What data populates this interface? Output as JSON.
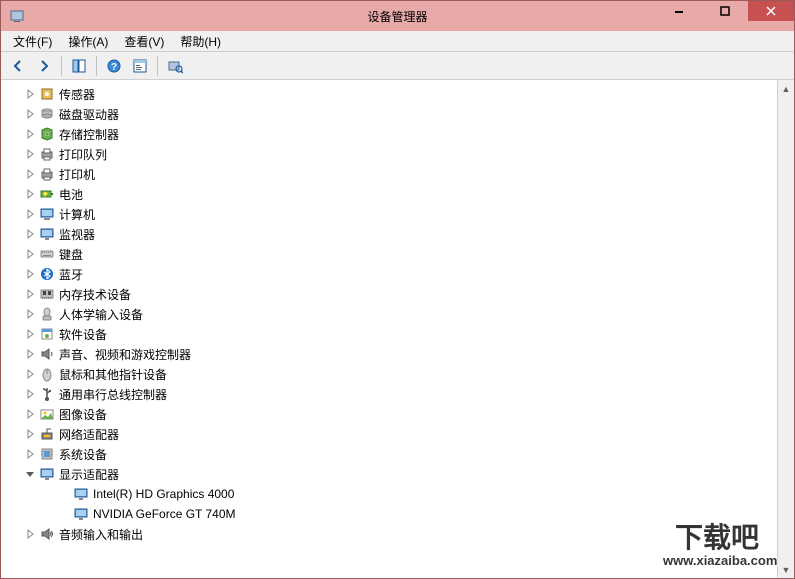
{
  "window": {
    "title": "设备管理器"
  },
  "menubar": {
    "file": "文件(F)",
    "action": "操作(A)",
    "view": "查看(V)",
    "help": "帮助(H)"
  },
  "tree": {
    "categories": [
      {
        "label": "传感器",
        "icon": "sensor",
        "expanded": false,
        "children": []
      },
      {
        "label": "磁盘驱动器",
        "icon": "disk",
        "expanded": false,
        "children": []
      },
      {
        "label": "存储控制器",
        "icon": "storage",
        "expanded": false,
        "children": []
      },
      {
        "label": "打印队列",
        "icon": "printqueue",
        "expanded": false,
        "children": []
      },
      {
        "label": "打印机",
        "icon": "printer",
        "expanded": false,
        "children": []
      },
      {
        "label": "电池",
        "icon": "battery",
        "expanded": false,
        "children": []
      },
      {
        "label": "计算机",
        "icon": "computer",
        "expanded": false,
        "children": []
      },
      {
        "label": "监视器",
        "icon": "monitor",
        "expanded": false,
        "children": []
      },
      {
        "label": "键盘",
        "icon": "keyboard",
        "expanded": false,
        "children": []
      },
      {
        "label": "蓝牙",
        "icon": "bluetooth",
        "expanded": false,
        "children": []
      },
      {
        "label": "内存技术设备",
        "icon": "memory",
        "expanded": false,
        "children": []
      },
      {
        "label": "人体学输入设备",
        "icon": "hid",
        "expanded": false,
        "children": []
      },
      {
        "label": "软件设备",
        "icon": "software",
        "expanded": false,
        "children": []
      },
      {
        "label": "声音、视频和游戏控制器",
        "icon": "sound",
        "expanded": false,
        "children": []
      },
      {
        "label": "鼠标和其他指针设备",
        "icon": "mouse",
        "expanded": false,
        "children": []
      },
      {
        "label": "通用串行总线控制器",
        "icon": "usb",
        "expanded": false,
        "children": []
      },
      {
        "label": "图像设备",
        "icon": "image",
        "expanded": false,
        "children": []
      },
      {
        "label": "网络适配器",
        "icon": "network",
        "expanded": false,
        "children": []
      },
      {
        "label": "系统设备",
        "icon": "system",
        "expanded": false,
        "children": []
      },
      {
        "label": "显示适配器",
        "icon": "display",
        "expanded": true,
        "children": [
          {
            "label": "Intel(R) HD Graphics 4000",
            "icon": "display"
          },
          {
            "label": "NVIDIA GeForce GT 740M",
            "icon": "display"
          }
        ]
      },
      {
        "label": "音频输入和输出",
        "icon": "audio",
        "expanded": false,
        "children": []
      }
    ]
  },
  "watermark": {
    "text1": "下载吧",
    "text2": "www.xiazaiba.com"
  }
}
